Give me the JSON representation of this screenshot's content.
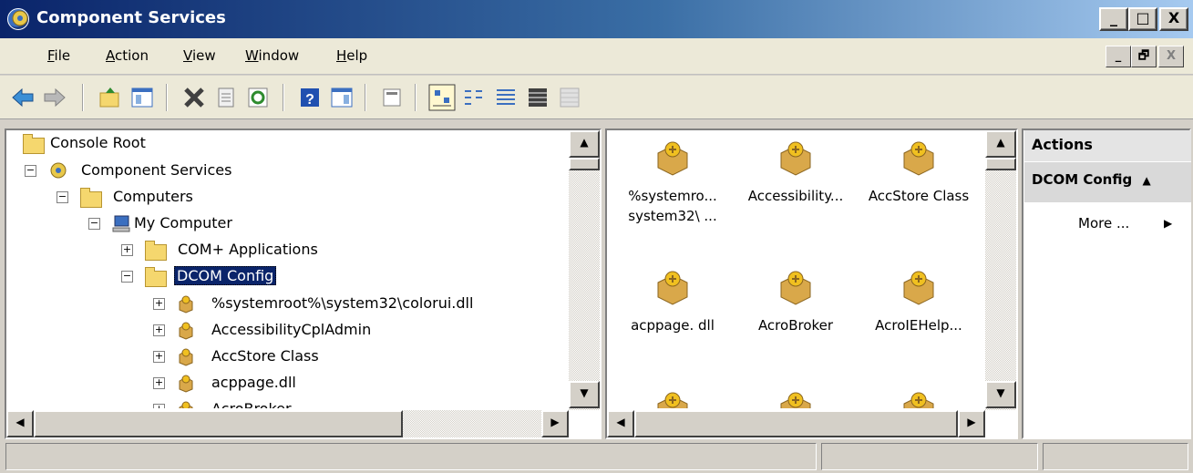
{
  "window": {
    "title": "Component Services",
    "controls": [
      "_",
      "□",
      "X"
    ],
    "mdi_controls": [
      "_",
      "🗗",
      "X"
    ]
  },
  "menu": {
    "items": [
      {
        "label": "File",
        "underline": "F",
        "rest": "ile"
      },
      {
        "label": "Action",
        "underline": "A",
        "rest": "ction"
      },
      {
        "label": "View",
        "underline": "V",
        "rest": "iew"
      },
      {
        "label": "Window",
        "underline": "W",
        "rest": "indow"
      },
      {
        "label": "Help",
        "underline": "H",
        "rest": "elp"
      }
    ]
  },
  "toolbar": {
    "buttons": [
      "back-icon",
      "forward-icon",
      "up-one-level-icon",
      "show-hide-console-tree-icon",
      "delete-icon",
      "properties-icon",
      "refresh-icon",
      "help-icon",
      "show-hide-action-pane-icon",
      "new-window-icon",
      "large-icons-view-icon",
      "small-icons-view-icon",
      "list-view-icon",
      "detail-view-icon",
      "disabled-view-icon"
    ]
  },
  "tree": {
    "items": [
      {
        "label": "Console Root",
        "icon": "folder-icon"
      },
      {
        "label": "Component Services",
        "icon": "component-services-icon",
        "expander": "−"
      },
      {
        "label": "Computers",
        "icon": "folder-icon",
        "expander": "−"
      },
      {
        "label": "My Computer",
        "icon": "computer-icon",
        "expander": "−"
      },
      {
        "label": "COM+ Applications",
        "icon": "folder-icon",
        "expander": "+"
      },
      {
        "label": "DCOM Config",
        "icon": "folder-icon",
        "expander": "−",
        "selected": true
      },
      {
        "label": "%systemroot%\\system32\\colorui.dll",
        "icon": "com-object-icon",
        "expander": "+"
      },
      {
        "label": "AccessibilityCplAdmin",
        "icon": "com-object-icon",
        "expander": "+"
      },
      {
        "label": "AccStore Class",
        "icon": "com-object-icon",
        "expander": "+"
      },
      {
        "label": "acppage.dll",
        "icon": "com-object-icon",
        "expander": "+"
      },
      {
        "label": "AcroBroker",
        "icon": "com-object-icon",
        "expander": "+"
      }
    ]
  },
  "list": {
    "items": [
      {
        "line1": "%systemro...",
        "line2": "system32\\ ..."
      },
      {
        "line1": "Accessibility...",
        "line2": ""
      },
      {
        "line1": "AccStore Class",
        "line2": ""
      },
      {
        "line1": "acppage. dll",
        "line2": ""
      },
      {
        "line1": "AcroBroker",
        "line2": ""
      },
      {
        "line1": "AcroIEHelp...",
        "line2": ""
      }
    ]
  },
  "actions": {
    "title": "Actions",
    "section": "DCOM Config",
    "section_arrow": "▲",
    "more": "More ...",
    "more_arrow": "▶"
  },
  "scroll": {
    "up": "▲",
    "down": "▼",
    "left": "◀",
    "right": "▶"
  }
}
